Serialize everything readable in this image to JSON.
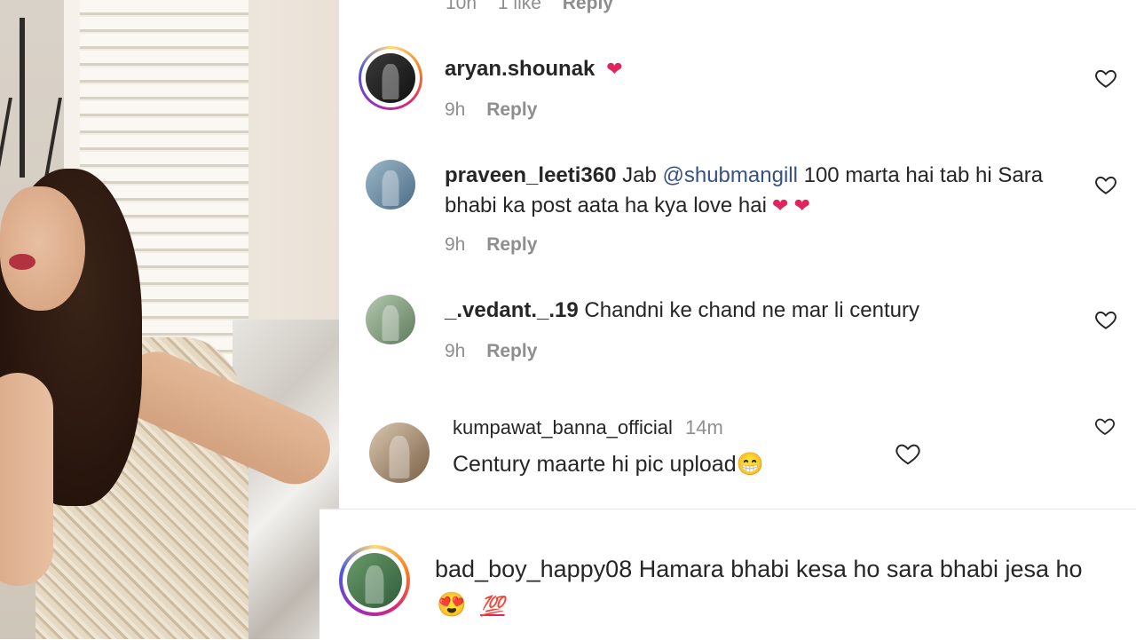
{
  "top_partial": {
    "time": "10h",
    "likes": "1 like",
    "reply": "Reply"
  },
  "comments": [
    {
      "username": "aryan.shounak",
      "text": "",
      "emoji": "❤",
      "time": "9h",
      "reply": "Reply"
    },
    {
      "username": "praveen_leeti360",
      "text_before": " Jab ",
      "mention": "@shubmangill",
      "text_after": " 100 marta hai tab hi Sara bhabi ka post aata ha kya love hai",
      "emoji": "❤ ❤",
      "time": "9h",
      "reply": "Reply"
    },
    {
      "username": "_.vedant._.19",
      "text": " Chandni ke chand ne mar li century",
      "time": "9h",
      "reply": "Reply"
    },
    {
      "username": "kumpawat_banna_official",
      "time": "14m",
      "text": "Century maarte hi pic upload",
      "emoji": "😁"
    }
  ],
  "bottom_comment": {
    "username": "bad_boy_happy08",
    "text": " Hamara bhabi kesa ho sara bhabi jesa ho",
    "emoji_1": "😍",
    "emoji_2": "💯"
  },
  "colors": {
    "mention": "#385185",
    "meta": "#8e8e8e",
    "heart": "#e0245e"
  },
  "icons": [
    "heart-outline-icon",
    "avatar",
    "story-ring"
  ]
}
